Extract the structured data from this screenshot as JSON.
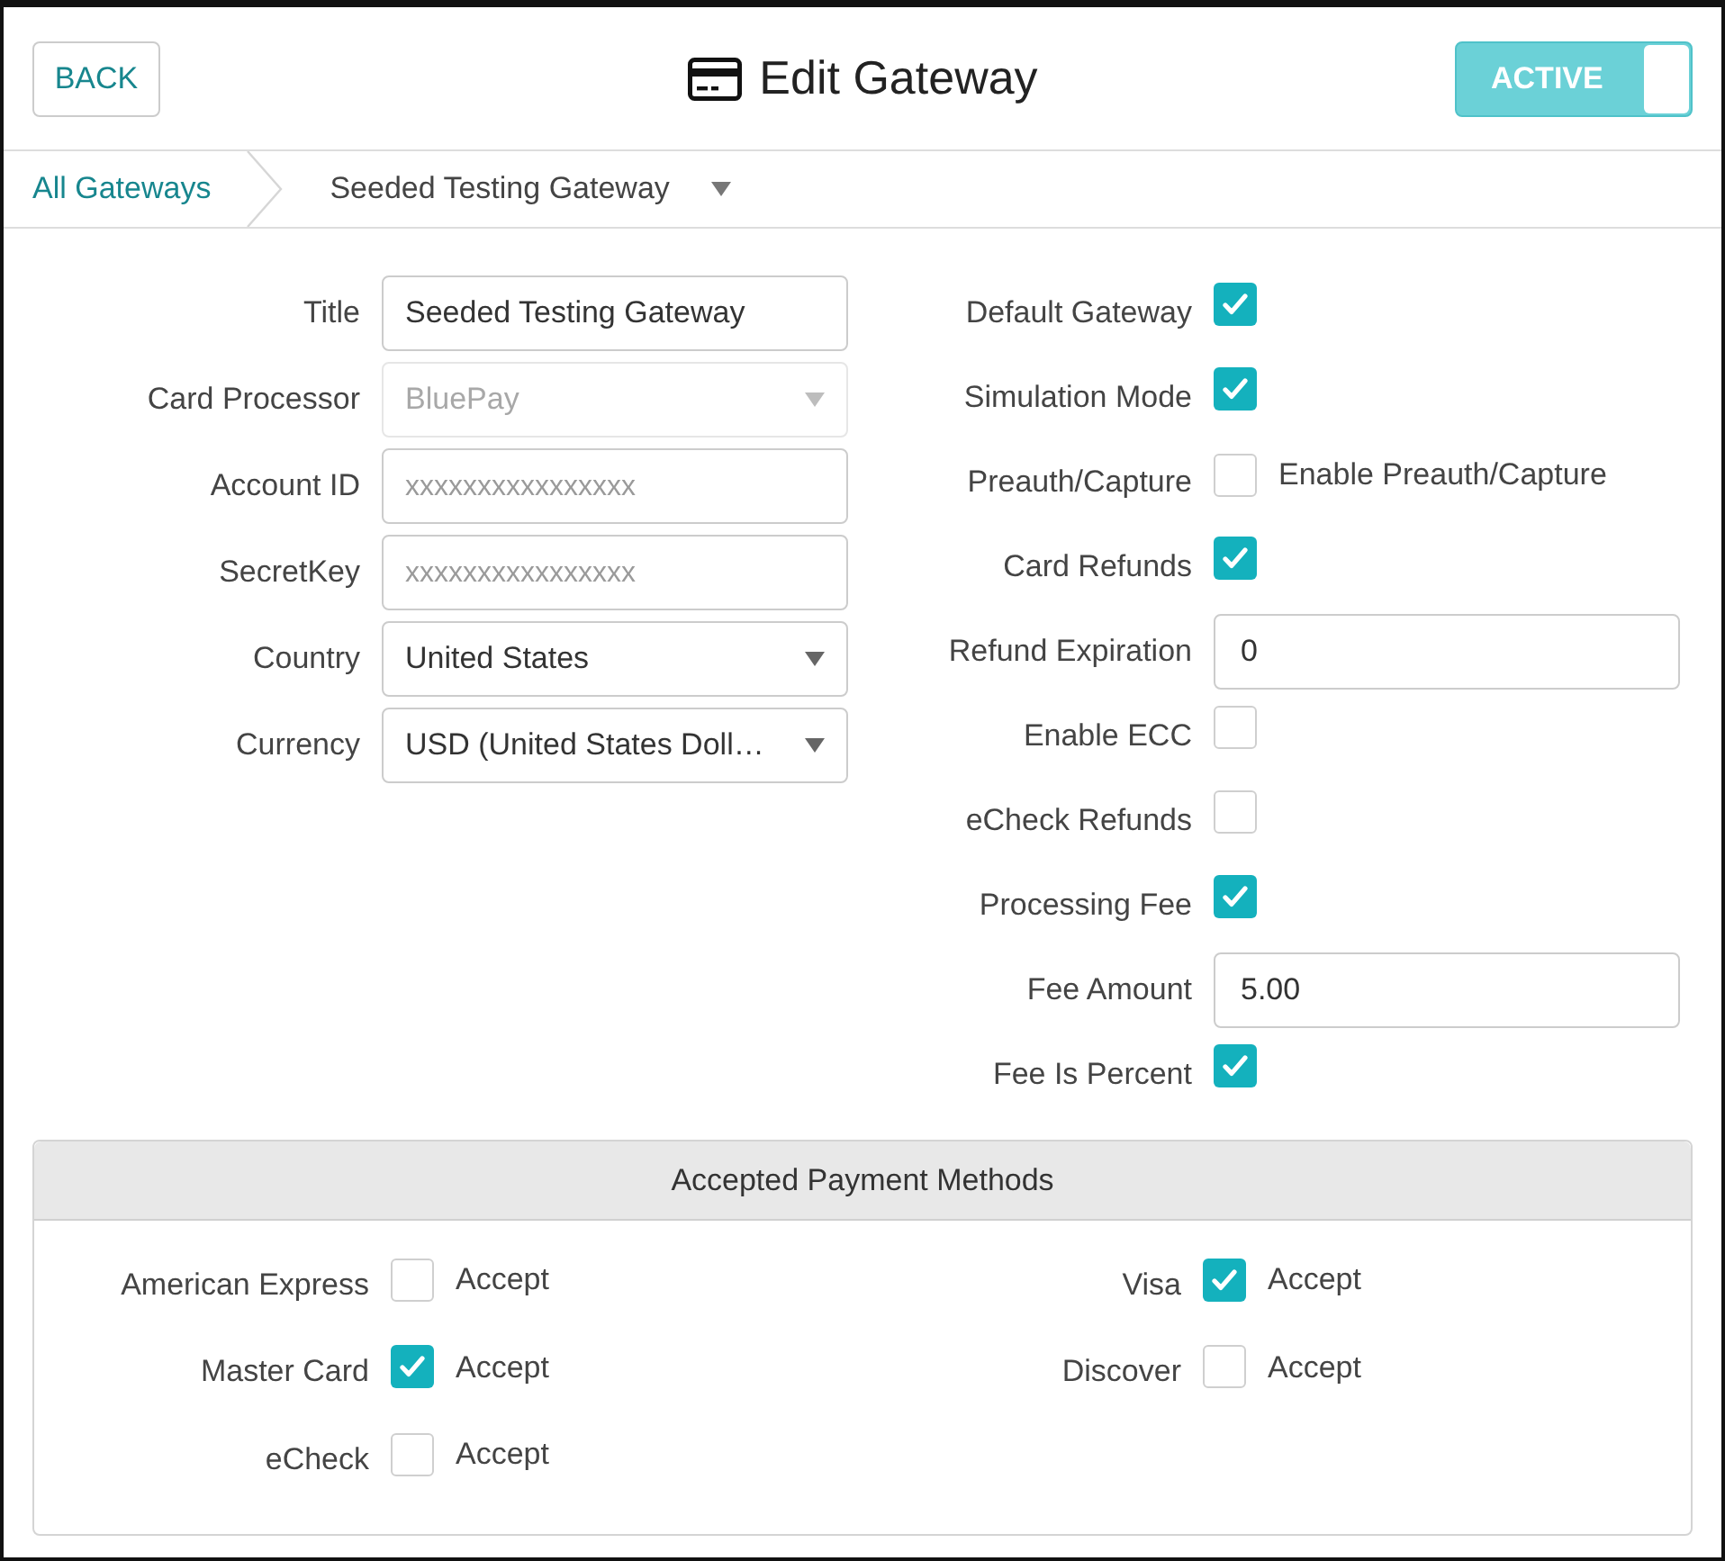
{
  "header": {
    "back_button": "BACK",
    "title": "Edit Gateway",
    "status_toggle": {
      "label": "ACTIVE",
      "on": true
    }
  },
  "breadcrumb": {
    "root": "All Gateways",
    "current": "Seeded Testing Gateway"
  },
  "left_fields": [
    {
      "label": "Title",
      "kind": "text",
      "value": "Seeded Testing Gateway",
      "disabled": false
    },
    {
      "label": "Card Processor",
      "kind": "select",
      "value": "BluePay",
      "disabled": true
    },
    {
      "label": "Account ID",
      "kind": "text",
      "placeholder": "xxxxxxxxxxxxxxxx",
      "disabled": false
    },
    {
      "label": "SecretKey",
      "kind": "text",
      "placeholder": "xxxxxxxxxxxxxxxx",
      "disabled": false
    },
    {
      "label": "Country",
      "kind": "select",
      "value": "United States",
      "disabled": false
    },
    {
      "label": "Currency",
      "kind": "select",
      "value": "USD (United States Doll…",
      "disabled": false
    }
  ],
  "right_fields": [
    {
      "label": "Default Gateway",
      "kind": "checkbox",
      "checked": true
    },
    {
      "label": "Simulation Mode",
      "kind": "checkbox",
      "checked": true
    },
    {
      "label": "Preauth/Capture",
      "kind": "checkbox",
      "checked": false,
      "option_label": "Enable Preauth/Capture"
    },
    {
      "label": "Card Refunds",
      "kind": "checkbox",
      "checked": true
    },
    {
      "label": "Refund Expiration",
      "kind": "input",
      "value": "0"
    },
    {
      "label": "Enable ECC",
      "kind": "checkbox",
      "checked": false
    },
    {
      "label": "eCheck Refunds",
      "kind": "checkbox",
      "checked": false
    },
    {
      "label": "Processing Fee",
      "kind": "checkbox",
      "checked": true
    },
    {
      "label": "Fee Amount",
      "kind": "input",
      "value": "5.00"
    },
    {
      "label": "Fee Is Percent",
      "kind": "checkbox",
      "checked": true
    }
  ],
  "payment_methods": {
    "title": "Accepted Payment Methods",
    "methods": [
      {
        "name": "American Express",
        "checked": false,
        "option_label": "Accept"
      },
      {
        "name": "Visa",
        "checked": true,
        "option_label": "Accept"
      },
      {
        "name": "Master Card",
        "checked": true,
        "option_label": "Accept"
      },
      {
        "name": "Discover",
        "checked": false,
        "option_label": "Accept"
      },
      {
        "name": "eCheck",
        "checked": false,
        "option_label": "Accept"
      }
    ]
  }
}
